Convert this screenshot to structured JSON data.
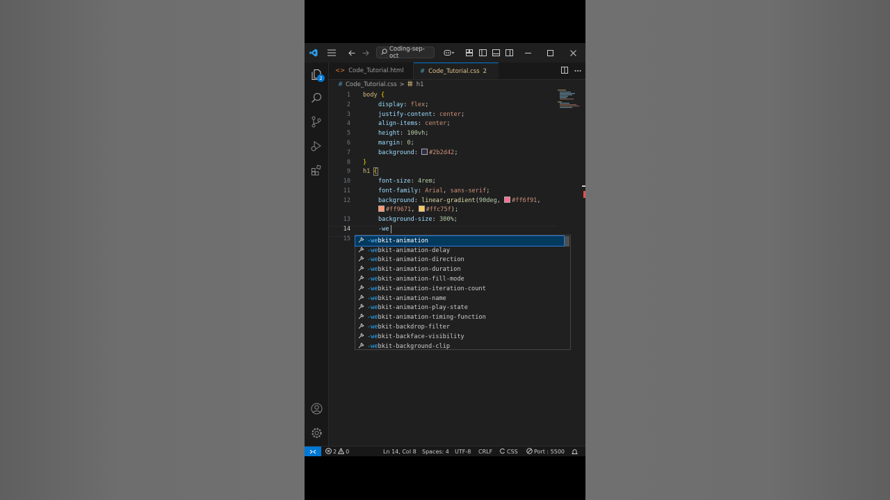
{
  "search": {
    "label": "Coding-sep-oct"
  },
  "activity": {
    "explorer_badge": "2"
  },
  "tabs": [
    {
      "label": "Code_Tutorial.html",
      "icon": "<>"
    },
    {
      "label": "Code_Tutorial.css",
      "problems": "2",
      "icon": "#"
    }
  ],
  "breadcrumb": {
    "file": "Code_Tutorial.css",
    "separator": ">",
    "symbol": "h1",
    "file_icon": "#"
  },
  "editor": {
    "line_numbers": [
      "1",
      "2",
      "3",
      "4",
      "5",
      "6",
      "7",
      "8",
      "9",
      "10",
      "11",
      "12",
      "",
      "13",
      "14",
      "15"
    ],
    "lines": {
      "l1_sel": "body",
      "l1_brace": "{",
      "l2_prop": "display",
      "l2_val": "flex",
      "l3_prop": "justify-content",
      "l3_val": "center",
      "l4_prop": "align-items",
      "l4_val": "center",
      "l5_prop": "height",
      "l5_val": "100vh",
      "l6_prop": "margin",
      "l6_val": "0",
      "l7_prop": "background",
      "l7_val": "#2b2d42",
      "l8_brace": "}",
      "l9_sel": "h1",
      "l9_brace": "{",
      "l10_prop": "font-size",
      "l10_val": "4rem",
      "l11_prop": "font-family",
      "l11_val1": "Arial",
      "l11_val2": "sans-serif",
      "l12_prop": "background",
      "l12_fn": "linear-gradient",
      "l12_arg1": "90deg",
      "l12_c1": "#ff6f91",
      "l12b_c2": "#ff9671",
      "l12b_c3": "#ffc75f",
      "l13_prop": "background-size",
      "l13_val": "300%",
      "l14_text": "-we"
    },
    "swatch_colors": [
      "#2b2d42",
      "#ff6f91",
      "#ff9671",
      "#ffc75f"
    ]
  },
  "suggestions": {
    "typed": "-we",
    "items": [
      "bkit-animation",
      "bkit-animation-delay",
      "bkit-animation-direction",
      "bkit-animation-duration",
      "bkit-animation-fill-mode",
      "bkit-animation-iteration-count",
      "bkit-animation-name",
      "bkit-animation-play-state",
      "bkit-animation-timing-function",
      "bkit-backdrop-filter",
      "bkit-backface-visibility",
      "bkit-background-clip"
    ]
  },
  "status": {
    "errors": "2",
    "warnings": "0",
    "position": "Ln 14, Col 8",
    "spaces": "Spaces: 4",
    "encoding": "UTF-8",
    "eol": "CRLF",
    "language": "CSS",
    "port": "Port : 5500"
  },
  "colors": {
    "accent": "#0078d4",
    "editor_bg": "#1f1f1f",
    "selector": "#d7ba7d",
    "property": "#9cdcfe",
    "value": "#ce9178"
  },
  "icons": [
    "vscode-logo-icon",
    "menu-icon",
    "back-arrow-icon",
    "forward-arrow-icon",
    "search-icon",
    "copilot-icon",
    "layout-icon",
    "explorer-icon",
    "source-control-icon",
    "run-debug-icon",
    "extensions-icon",
    "account-icon",
    "settings-gear-icon",
    "split-editor-icon",
    "more-icon",
    "wrench-icon",
    "error-icon",
    "warning-icon",
    "bell-icon",
    "remote-icon"
  ]
}
